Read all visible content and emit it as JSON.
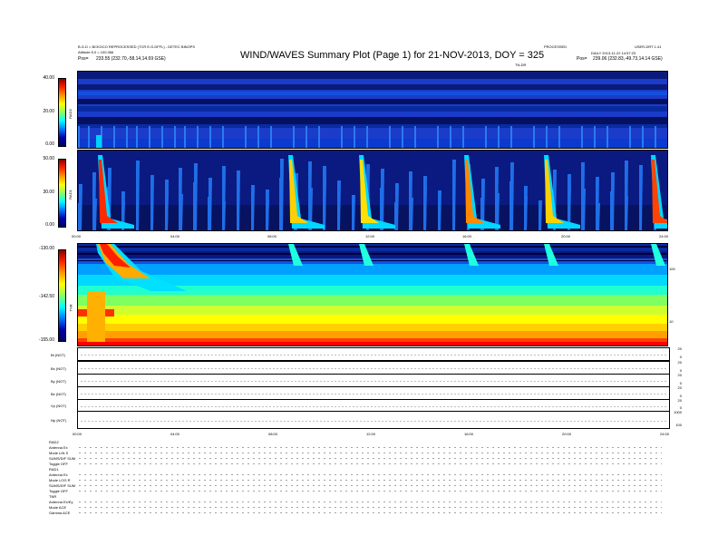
{
  "header": {
    "left_line1": "B.G.D = BCKGCO REPROCESSED (TCR E.G.DFFL) - DETEC BINOPS",
    "left_line2": "Attitude 5.0 = 100.066",
    "left_line3_label": "Pos=",
    "left_line3_value": "233.55 (232.70,-58.14,14.69 GSE)",
    "title": "WIND/WAVES Summary Plot (Page 1) for 21-NOV-2013, DOY = 325",
    "center_right": "PROCESSED",
    "right_line1": "USER-DRT 1.41",
    "right_line2": "DAILY 2013-11-22 14:57:23",
    "right_line3_label": "Pos=",
    "right_line3_value": "239.06 (232.83,-49.73,14.14 GSE)",
    "tnr_label": "TN-DR"
  },
  "colors": {
    "axis": "#000000",
    "spectrum_hot": "#ff0000",
    "spectrum_cold": "#000080",
    "spectrum_mid": "#00c8ff"
  },
  "chart_data": [
    {
      "type": "heatmap",
      "panel": "RAD2",
      "ylabel": "RAD2",
      "yticks": [
        "40.00",
        "20.00",
        "0.00"
      ],
      "ylim": [
        0,
        40
      ]
    },
    {
      "type": "heatmap",
      "panel": "RAD1",
      "ylabel": "RAD1",
      "yticks": [
        "50.00",
        "30.00",
        "0.00"
      ],
      "ylim": [
        0,
        50
      ],
      "xticks": [
        "00:00",
        "04:00",
        "08:00",
        "12:00",
        "16:00",
        "20:00",
        "24:00"
      ],
      "xlim": [
        "00:00",
        "24:00"
      ]
    },
    {
      "type": "heatmap",
      "panel": "TNR",
      "ylabel": "TNR",
      "yticks": [
        "-130.00",
        "-142.50",
        "-155.00"
      ],
      "ylim": [
        -155,
        -130
      ],
      "right_ticks": [
        "100",
        "10"
      ],
      "xticks": [
        "00:00",
        "04:00",
        "08:00",
        "12:00",
        "16:00",
        "20:00",
        "24:00"
      ]
    },
    {
      "type": "line",
      "panels": [
        {
          "label": "Bt (NOT)",
          "right_ticks": [
            "20",
            "0"
          ]
        },
        {
          "label": "Bx (NOT)",
          "right_ticks": [
            "20",
            "0"
          ]
        },
        {
          "label": "By (NOT)",
          "right_ticks": [
            "20",
            "0"
          ]
        },
        {
          "label": "Bz (NOT)",
          "right_ticks": [
            "20",
            "0"
          ]
        },
        {
          "label": "Vp (NOT)",
          "right_ticks": [
            "20",
            "0"
          ]
        },
        {
          "label": "Np (NOT)",
          "right_ticks": [
            "1000",
            "100"
          ]
        }
      ],
      "xticks": [
        "00:00",
        "04:00",
        "08:00",
        "12:00",
        "16:00",
        "20:00",
        "24:00"
      ]
    }
  ],
  "summary": {
    "rad2_heading": "RAD2",
    "rad2_rows": [
      "Antenna  Ex",
      "Mode   LIN S",
      "SUMS/DIF  SUM",
      "Toggle   OFF"
    ],
    "rad1_heading": "RAD1",
    "rad1_rows": [
      "Antenna  Ex",
      "Mode   LOG R",
      "SUMS/DIF  SUM",
      "Toggle   OFF"
    ],
    "tnr_heading": "TNR",
    "tnr_rows": [
      "Antenna  Ex/Ey",
      "Mode   ACE",
      "Gamma   ACE"
    ]
  }
}
